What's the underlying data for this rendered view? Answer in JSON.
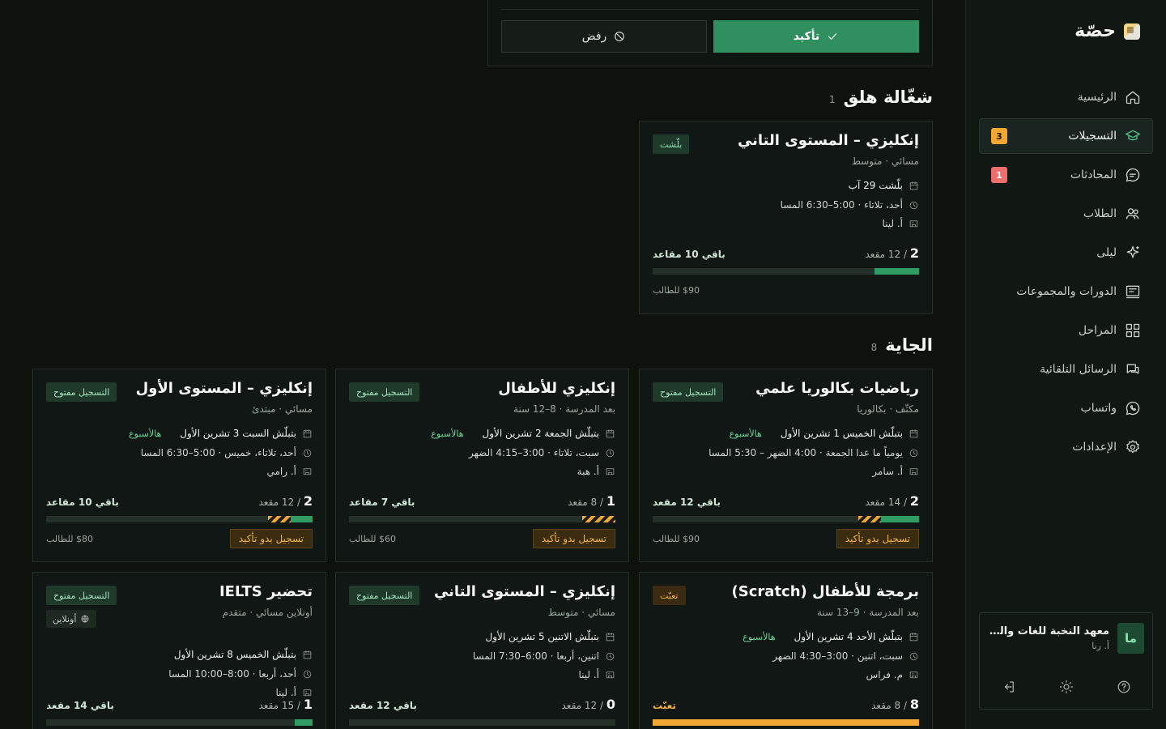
{
  "app": {
    "brand": "حصّة"
  },
  "nav": [
    {
      "label": "الرئيسية",
      "icon": "home-icon",
      "active": false,
      "badge": ""
    },
    {
      "label": "التسجيلات",
      "icon": "graduation-cap-icon",
      "active": true,
      "badge": "3",
      "badge_color": "#f0a832"
    },
    {
      "label": "المحادثات",
      "icon": "chat-bubble-icon",
      "active": false,
      "badge": "1",
      "badge_color": "#ee6e6e"
    },
    {
      "label": "الطلاب",
      "icon": "users-icon",
      "active": false,
      "badge": ""
    },
    {
      "label": "ليلى",
      "icon": "sparkle-icon",
      "active": false,
      "badge": ""
    },
    {
      "label": "الدورات والمجموعات",
      "icon": "board-icon",
      "active": false,
      "badge": ""
    },
    {
      "label": "المراحل",
      "icon": "grid-icon",
      "active": false,
      "badge": ""
    },
    {
      "label": "الرسائل التلقائية",
      "icon": "messages-icon",
      "active": false,
      "badge": ""
    },
    {
      "label": "واتساب",
      "icon": "whatsapp-icon",
      "active": false,
      "badge": ""
    },
    {
      "label": "الإعدادات",
      "icon": "gear-icon",
      "active": false,
      "badge": ""
    }
  ],
  "org": {
    "avatar": "ما",
    "name": "معهد النخبة للغات والت...",
    "user": "أ. رنا"
  },
  "confirm": {
    "confirm_label": "تأكيد",
    "reject_label": "رفض"
  },
  "sections": {
    "running": {
      "title": "شغّالة هلق",
      "count": "1"
    },
    "upcoming": {
      "title": "الجاية",
      "count": "8"
    }
  },
  "running_card": {
    "title": "إنكليزي – المستوى التاني",
    "sub": "مسائي · متوسط",
    "status": "بلّشت",
    "start": "بلّشت 29 آب",
    "schedule": "أحد، تلاتاء · 5:00–6:30 المسا",
    "teacher": "أ. لينا",
    "enrolled": "2",
    "capacity": "12",
    "seat_word": "مقعد",
    "left": "باقي 10 مقاعد",
    "fill": 0.167,
    "price": "$90 للطالب"
  },
  "cards": [
    {
      "title": "رياضيات بكالوريا علمي",
      "sub": "مكثّف · بكالوريا",
      "status": "التسجيل مفتوح",
      "status_type": "open",
      "start": "بتبلّش الخميس 1 تشرين الأول",
      "this_week": "هالأسبوع",
      "schedule": "يومياً ما عدا الجمعة · 4:00 الضهر – 5:30 المسا",
      "teacher": "أ. سامر",
      "enrolled": "2",
      "capacity": "14",
      "seat_word": "مقعد",
      "left": "باقي 12 مقعد",
      "fill": 0.143,
      "pending": 0.086,
      "price": "$90 للطالب",
      "unconfirmed": "تسجيل بدو تأكيد"
    },
    {
      "title": "إنكليزي للأطفال",
      "sub": "بعد المدرسة · 8–12 سنة",
      "status": "التسجيل مفتوح",
      "status_type": "open",
      "start": "بتبلّش الجمعة 2 تشرين الأول",
      "this_week": "هالأسبوع",
      "schedule": "سبت، تلاتاء · 3:00–4:15 الضهر",
      "teacher": "أ. هبة",
      "enrolled": "1",
      "capacity": "8",
      "seat_word": "مقعد",
      "left": "باقي 7 مقاعد",
      "fill": 0.0,
      "pending": 0.125,
      "price": "$60 للطالب",
      "unconfirmed": "تسجيل بدو تأكيد"
    },
    {
      "title": "إنكليزي – المستوى الأول",
      "sub": "مسائي · مبتدئ",
      "status": "التسجيل مفتوح",
      "status_type": "open",
      "start": "بتبلّش السبت 3 تشرين الأول",
      "this_week": "هالأسبوع",
      "schedule": "أحد، تلاتاء، خميس · 5:00–6:30 المسا",
      "teacher": "أ. رامي",
      "enrolled": "2",
      "capacity": "12",
      "seat_word": "مقعد",
      "left": "باقي 10 مقاعد",
      "fill": 0.083,
      "pending": 0.083,
      "price": "$80 للطالب",
      "unconfirmed": "تسجيل بدو تأكيد"
    },
    {
      "title": "برمجة للأطفال (Scratch)",
      "sub": "بعد المدرسة · 9–13 سنة",
      "status": "تعبّت",
      "status_type": "full",
      "start": "بتبلّش الأحد 4 تشرين الأول",
      "this_week": "هالأسبوع",
      "schedule": "سبت، اتنين · 3:00–4:30 الضهر",
      "teacher": "م. فراس",
      "enrolled": "8",
      "capacity": "8",
      "seat_word": "مقعد",
      "left": "تعبّت",
      "fill": 1.0,
      "pending": 0,
      "price": "",
      "unconfirmed": ""
    },
    {
      "title": "إنكليزي – المستوى التاني",
      "sub": "مسائي · متوسط",
      "status": "التسجيل مفتوح",
      "status_type": "open",
      "start": "بتبلّش الاتنين 5 تشرين الأول",
      "this_week": "",
      "schedule": "اتنين، أربعا · 6:00–7:30 المسا",
      "teacher": "أ. لينا",
      "enrolled": "0",
      "capacity": "12",
      "seat_word": "مقعد",
      "left": "باقي 12 مقعد",
      "fill": 0.0,
      "pending": 0,
      "price": "",
      "unconfirmed": ""
    },
    {
      "title": "تحضير IELTS",
      "sub": "أونلاين مسائي · متقدم",
      "status": "التسجيل مفتوح",
      "status_type": "open",
      "online": "أونلاين",
      "start": "بتبلّش الخميس 8 تشرين الأول",
      "this_week": "",
      "schedule": "أحد، أربعا · 8:00–10:00 المسا",
      "teacher": "أ. لينا",
      "enrolled": "1",
      "capacity": "15",
      "seat_word": "مقعد",
      "left": "باقي 14 مقعد",
      "fill": 0.067,
      "pending": 0,
      "price": "",
      "unconfirmed": ""
    }
  ]
}
